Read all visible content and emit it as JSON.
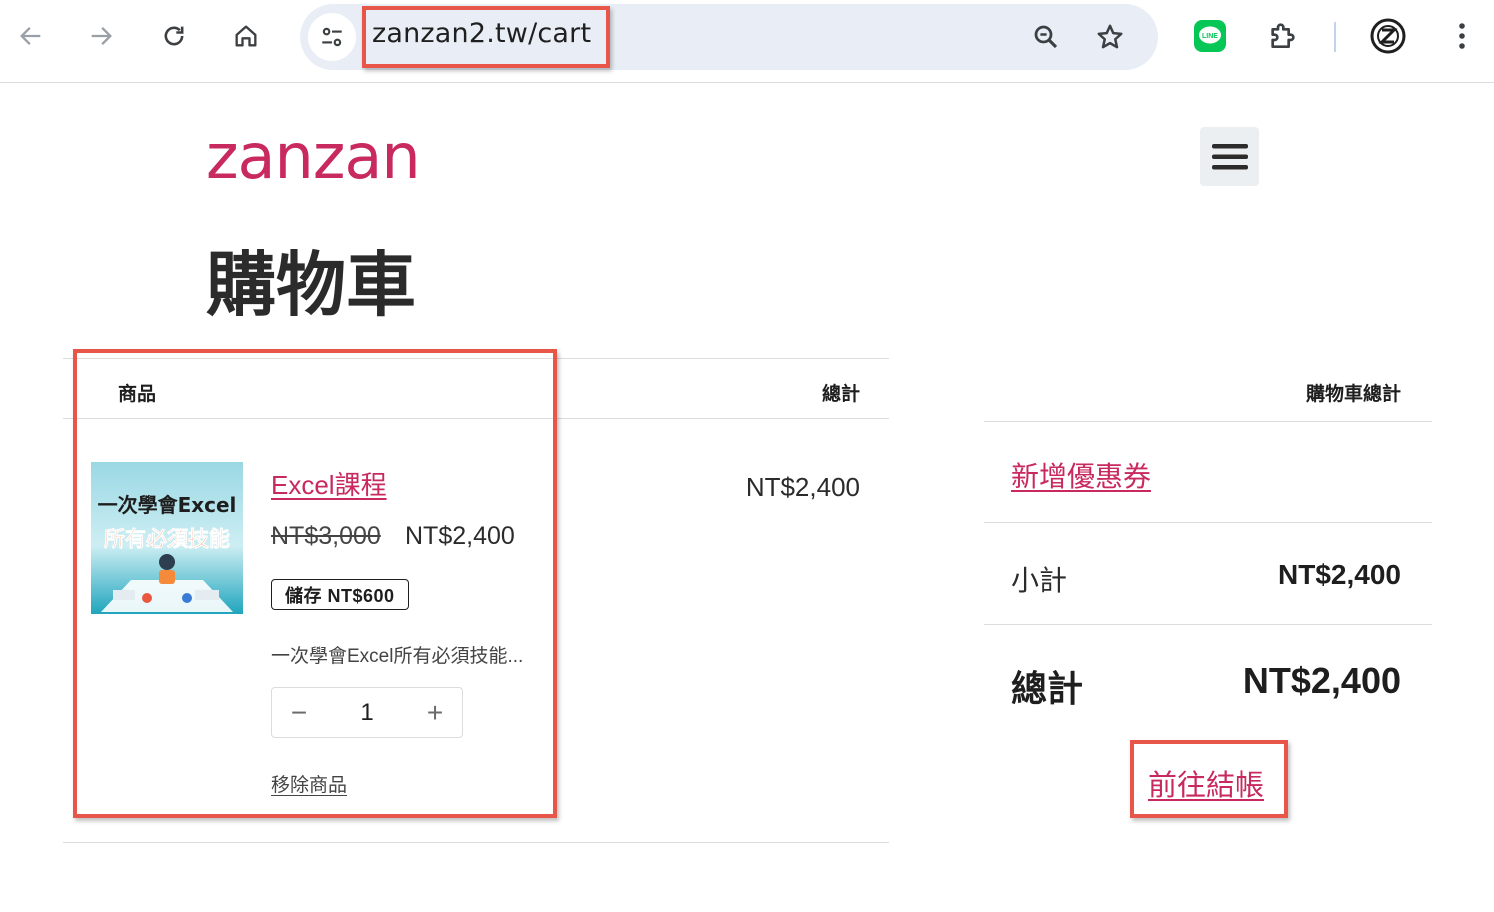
{
  "browser": {
    "url": "zanzan2.tw/cart",
    "line_ext_label": "LINE"
  },
  "site": {
    "logo": "zanzan"
  },
  "page": {
    "title": "購物車"
  },
  "cart_table": {
    "headers": {
      "product": "商品",
      "total": "總計"
    },
    "items": [
      {
        "thumbnail_text_top": "一次學會Excel",
        "thumbnail_text_bottom": "所有必須技能",
        "name": "Excel課程",
        "original_price": "NT$3,000",
        "sale_price": "NT$2,400",
        "savings_badge": "儲存 NT$600",
        "description": "一次學會Excel所有必須技能...",
        "quantity": "1",
        "qty_minus": "−",
        "qty_plus": "+",
        "remove_label": "移除商品",
        "line_total": "NT$2,400"
      }
    ]
  },
  "cart_totals": {
    "header": "購物車總計",
    "coupon_link": "新增優惠券",
    "subtotal_label": "小計",
    "subtotal_value": "NT$2,400",
    "total_label": "總計",
    "total_value": "NT$2,400",
    "checkout_label": "前往結帳"
  },
  "colors": {
    "brand": "#c8295f",
    "annotation": "#e8564a",
    "line_green": "#06c755"
  }
}
